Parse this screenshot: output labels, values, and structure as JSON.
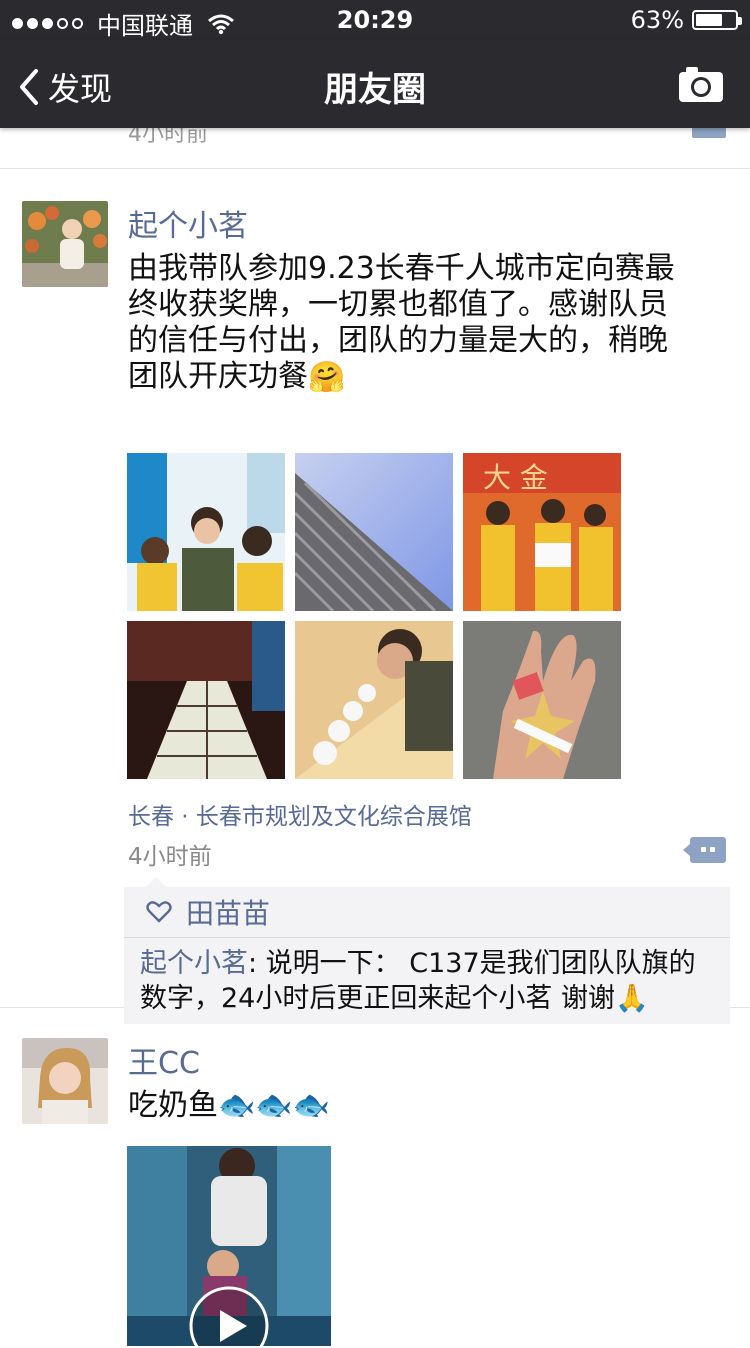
{
  "status_bar": {
    "carrier": "中国联通",
    "time": "20:29",
    "battery": "63%",
    "battery_level": 0.63
  },
  "nav": {
    "back_label": "发现",
    "title": "朋友圈",
    "camera_icon": "camera-icon"
  },
  "previous_post": {
    "time": "4小时前"
  },
  "post1": {
    "name": "起个小茗",
    "text": "由我带队参加9.23长春千人城市定向赛最终收获奖牌，一切累也都值了。感谢队员的信任与付出，团队的力量是大的，稍晚团队开庆功餐",
    "emoji": "🤗",
    "location": "长春 · 长春市规划及文化综合展馆",
    "time": "4小时前",
    "likes": [
      "田苗苗"
    ],
    "comments": [
      {
        "name": "起个小茗",
        "text": ": 说明一下：  C137是我们团队队旗的数字，24小时后更正回来起个小茗 谢谢",
        "emoji": "🙏"
      }
    ]
  },
  "post2": {
    "name": "王CC",
    "text": "吃奶鱼",
    "emoji": "🐟🐟🐟"
  },
  "colors": {
    "bar_bg": "#2b2b2f",
    "name_link": "#576b95",
    "action_btn": "#8ea3c3",
    "comment_bg": "#f3f3f5"
  }
}
